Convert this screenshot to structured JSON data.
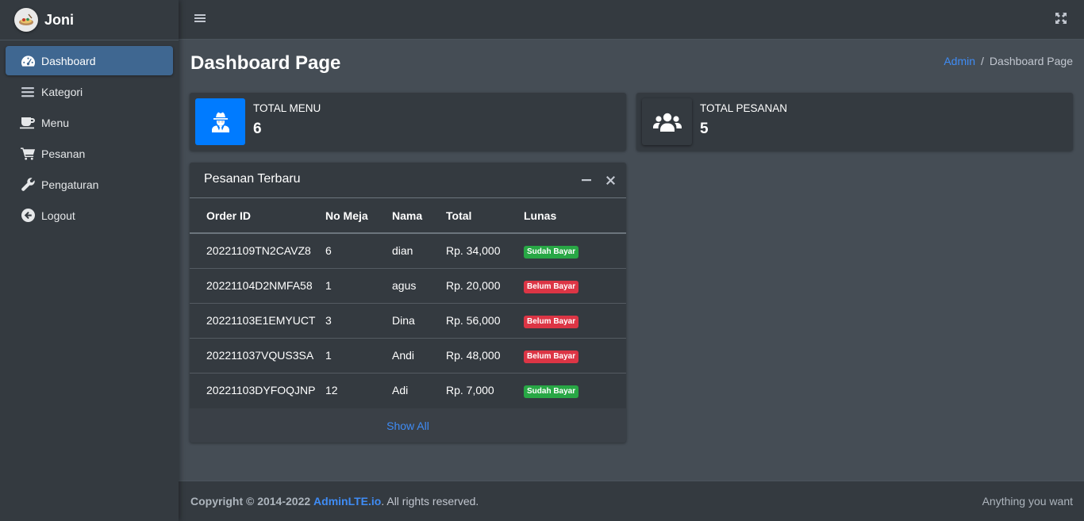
{
  "brand": {
    "name": "Joni"
  },
  "sidebar": {
    "items": [
      {
        "label": "Dashboard",
        "icon": "tachometer-icon",
        "active": true
      },
      {
        "label": "Kategori",
        "icon": "bars-icon"
      },
      {
        "label": "Menu",
        "icon": "coffee-icon"
      },
      {
        "label": "Pesanan",
        "icon": "shopping-cart-icon"
      },
      {
        "label": "Pengaturan",
        "icon": "wrench-icon"
      },
      {
        "label": "Logout",
        "icon": "arrow-circle-left-icon"
      }
    ]
  },
  "header": {
    "title": "Dashboard Page"
  },
  "breadcrumb": {
    "link": "Admin",
    "separator": "/",
    "current": "Dashboard Page"
  },
  "info_boxes": [
    {
      "label": "TOTAL MENU",
      "value": "6",
      "icon": "user-secret-icon",
      "color": "#007bff"
    },
    {
      "label": "TOTAL PESANAN",
      "value": "5",
      "icon": "users-icon"
    }
  ],
  "orders_card": {
    "title": "Pesanan Terbaru",
    "columns": [
      "Order ID",
      "No Meja",
      "Nama",
      "Total",
      "Lunas"
    ],
    "rows": [
      {
        "order_id": "20221109TN2CAVZ8",
        "table": "6",
        "name": "dian",
        "total": "Rp. 34,000",
        "status": "Sudah Bayar",
        "paid": true
      },
      {
        "order_id": "20221104D2NMFA58",
        "table": "1",
        "name": "agus",
        "total": "Rp. 20,000",
        "status": "Belum Bayar",
        "paid": false
      },
      {
        "order_id": "20221103E1EMYUCT",
        "table": "3",
        "name": "Dina",
        "total": "Rp. 56,000",
        "status": "Belum Bayar",
        "paid": false
      },
      {
        "order_id": "202211037VQUS3SA",
        "table": "1",
        "name": "Andi",
        "total": "Rp. 48,000",
        "status": "Belum Bayar",
        "paid": false
      },
      {
        "order_id": "20221103DYFOQJNP",
        "table": "12",
        "name": "Adi",
        "total": "Rp. 7,000",
        "status": "Sudah Bayar",
        "paid": true
      }
    ],
    "footer_link": "Show All"
  },
  "footer": {
    "copyright_prefix": "Copyright © 2014-2022",
    "brand_link": "AdminLTE.io",
    "suffix": ". All rights reserved.",
    "right_text": "Anything you want"
  },
  "colors": {
    "accent": "#007bff",
    "active_nav": "#3f6791",
    "success": "#28a745",
    "danger": "#dc3545",
    "link": "#3f8cf5"
  }
}
